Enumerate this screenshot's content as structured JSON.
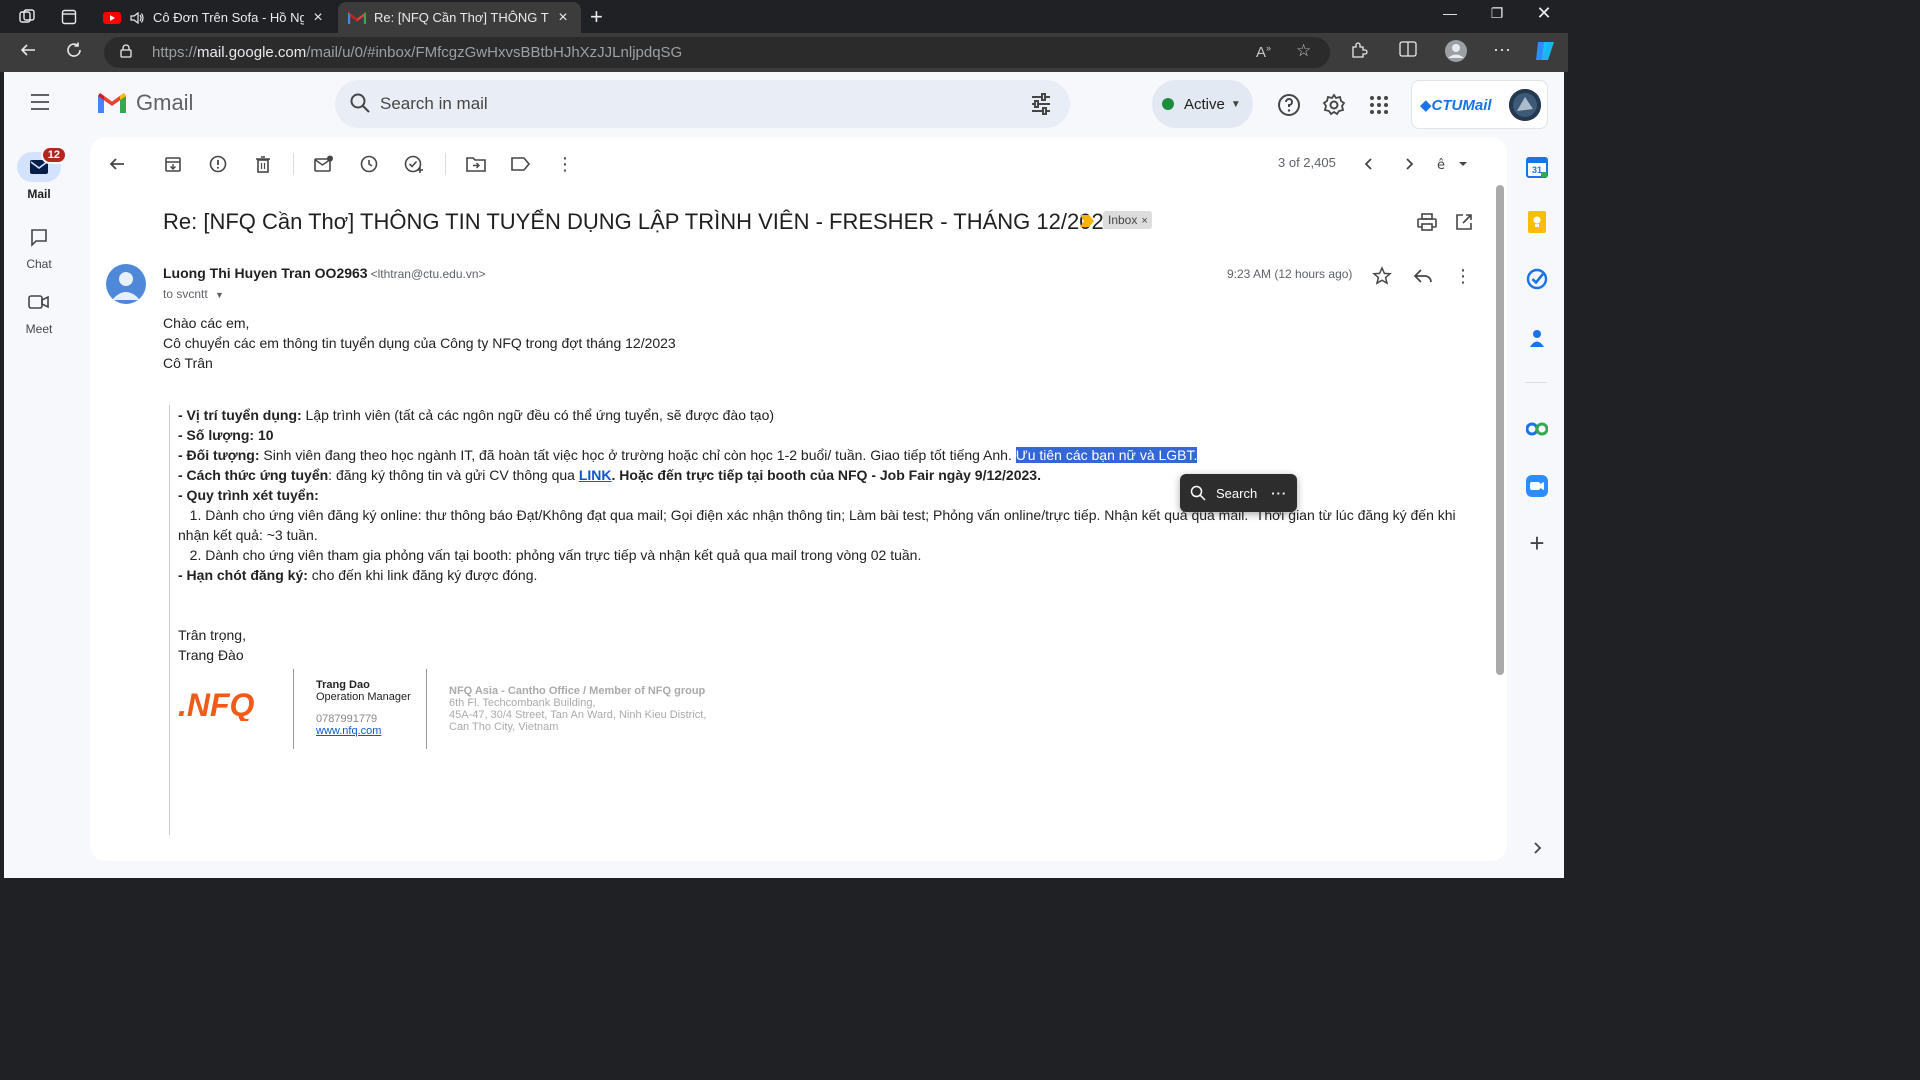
{
  "browser": {
    "tabs": [
      {
        "title": "Cô Đơn Trên Sofa - Hồ Ngọc Hà",
        "active": false
      },
      {
        "title": "Re: [NFQ Cần Thơ] THÔNG TIN TUYỂN DỤNG",
        "active": true
      }
    ],
    "url_prefix": "https://",
    "url_host": "mail.google.com",
    "url_path": "/mail/u/0/#inbox/FMfcgzGwHxvsBBtbHJhXzJJLnljpdqSG"
  },
  "gmail": {
    "logo_text": "Gmail",
    "search_placeholder": "Search in mail",
    "status": "Active",
    "account_brand": "CTUMail"
  },
  "leftnav": [
    {
      "label": "Mail",
      "badge": "12"
    },
    {
      "label": "Chat"
    },
    {
      "label": "Meet"
    }
  ],
  "toolbar": {
    "pager": "3 of 2,405"
  },
  "message": {
    "subject": "Re: [NFQ Cần Thơ] THÔNG TIN TUYỂN DỤNG LẬP TRÌNH VIÊN - FRESHER - THÁNG 12/2023",
    "label": "Inbox",
    "sender_name": "Luong Thi Huyen Tran OO2963",
    "sender_email": "<lthtran@ctu.edu.vn>",
    "to": "to svcntt",
    "time": "9:23 AM (12 hours ago)",
    "greeting": "Chào các em,",
    "line2": "Cô chuyển các em thông tin tuyển dụng của Công ty NFQ trong đợt tháng 12/2023",
    "signoff": "Cô Trân"
  },
  "quoted": {
    "pos_label": "- Vị trí tuyển dụng:",
    "pos_value": " Lập trình viên (tất cả các ngôn ngữ đều có thể ứng tuyển, sẽ được đào tạo)",
    "qty": "- Số lượng: 10",
    "target_label": "- Đối tượng:",
    "target_value": " Sinh viên đang theo học ngành IT, đã hoàn tất việc học ở trường hoặc chỉ còn học 1-2 buổi/ tuần. Giao tiếp tốt tiếng Anh. ",
    "target_selected": "Ưu tiên các bạn nữ và LGBT.",
    "apply_label": "- Cách thức ứng tuyển",
    "apply_value": ": đăng ký thông tin và gửi CV thông qua ",
    "apply_link": "LINK",
    "apply_tail": ". Hoặc đến trực tiếp tại booth của NFQ - Job Fair ngày 9/12/2023.",
    "process_label": "- Quy trình xét tuyển:",
    "process_1": "   1. Dành cho ứng viên đăng ký online: thư thông báo Đạt/Không đạt qua mail; Gọi điện xác nhận thông tin; Làm bài test; Phỏng vấn online/trực tiếp. Nhận kết quả qua mail.  Thời gian từ lúc đăng ký đến khi nhận kết quả: ~3 tuần.",
    "process_2": "   2. Dành cho ứng viên tham gia phỏng vấn tại booth: phỏng vấn trực tiếp và nhận kết quả qua mail trong vòng 02 tuần.",
    "deadline_label": "- Hạn chót đăng ký:",
    "deadline_value": " cho đến khi link đăng ký được đóng.",
    "regards": "Trân trọng,",
    "name": "Trang Đào"
  },
  "signature": {
    "logo_text": ".NFQ",
    "name": "Trang Dao",
    "role": "Operation Manager",
    "phone": "0787991779",
    "website": "www.nfq.com",
    "office": "NFQ Asia - Cantho Office / Member of NFQ group",
    "addr1": "6th Fl. Techcombank Building,",
    "addr2": "45A-47, 30/4 Street, Tan An Ward, Ninh Kieu District,",
    "addr3": "Can Tho City, Vietnam"
  },
  "popup": {
    "label": "Search"
  },
  "colors": {
    "accent": "#0b57d0",
    "selection": "#3367d6",
    "badge": "#b3261e",
    "active_dot": "#1e8e3e"
  }
}
